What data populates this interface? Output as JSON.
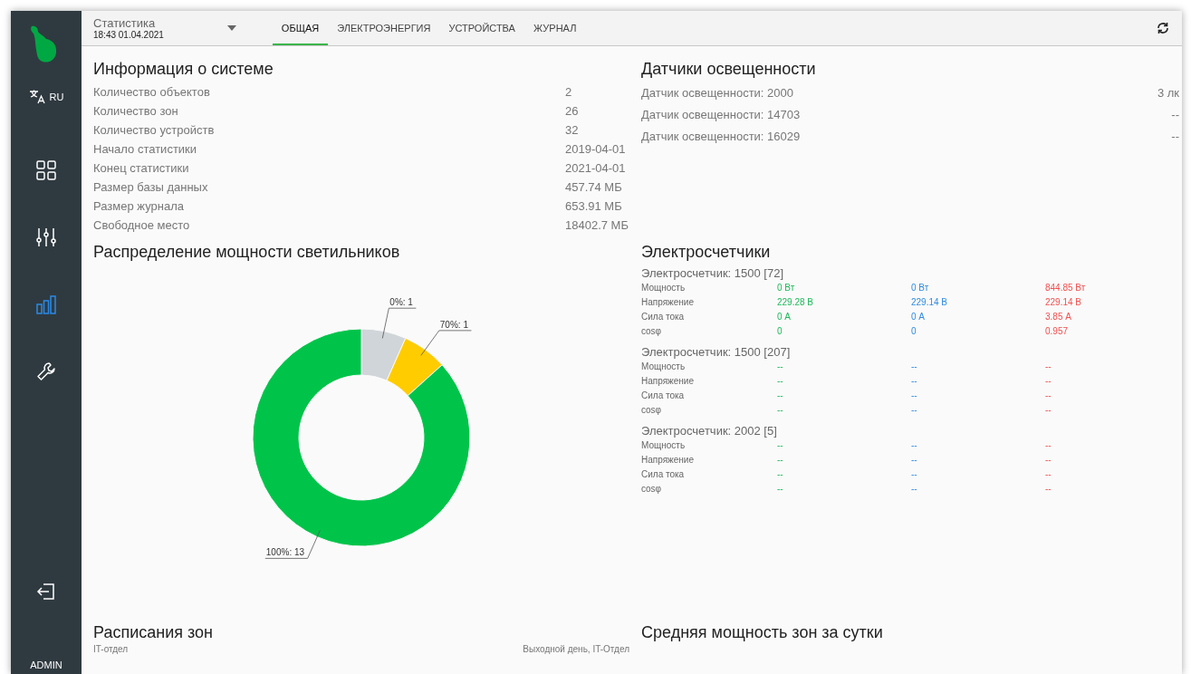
{
  "sidebar": {
    "language": "RU",
    "items": [
      {
        "selected": false
      },
      {
        "selected": false
      },
      {
        "selected": true
      },
      {
        "selected": false
      }
    ],
    "user": "ADMIN"
  },
  "header": {
    "title": "Статистика",
    "datetime": "18:43 01.04.2021",
    "tabs": [
      {
        "label": "ОБЩАЯ",
        "selected": true
      },
      {
        "label": "ЭЛЕКТРОЭНЕРГИЯ",
        "selected": false
      },
      {
        "label": "УСТРОЙСТВА",
        "selected": false
      },
      {
        "label": "ЖУРНАЛ",
        "selected": false
      }
    ]
  },
  "system_info": {
    "title": "Информация о системе",
    "rows": [
      {
        "label": "Количество объектов",
        "value": "2"
      },
      {
        "label": "Количество зон",
        "value": "26"
      },
      {
        "label": "Количество устройств",
        "value": "32"
      },
      {
        "label": "Начало статистики",
        "value": "2019-04-01"
      },
      {
        "label": "Конец статистики",
        "value": "2021-04-01"
      },
      {
        "label": "Размер базы данных",
        "value": "457.74 МБ"
      },
      {
        "label": "Размер журнала",
        "value": "653.91 МБ"
      },
      {
        "label": "Свободное место",
        "value": "18402.7 МБ"
      }
    ]
  },
  "light_sensors": {
    "title": "Датчики освещенности",
    "rows": [
      {
        "label": "Датчик освещенности: 2000",
        "value": "3 лк"
      },
      {
        "label": "Датчик освещенности: 14703",
        "value": "--"
      },
      {
        "label": "Датчик освещенности: 16029",
        "value": "--"
      }
    ]
  },
  "power_distribution": {
    "title": "Распределение мощности светильников",
    "chart_data": {
      "type": "donut",
      "values": [
        1,
        1,
        13
      ],
      "colors": [
        "#d0d5d9",
        "#ffcc00",
        "#00c44a"
      ],
      "value_labels": [
        "0%: 1",
        "70%: 1",
        "100%: 13"
      ]
    }
  },
  "meters": {
    "title": "Электросчетчики",
    "phases": [
      {
        "color": "#1fb85a"
      },
      {
        "color": "#2f8be0"
      },
      {
        "color": "#f25050"
      }
    ],
    "items": [
      {
        "name": "Электросчетчик: 1500 [72]",
        "rows": [
          {
            "label": "Мощность",
            "values": [
              "0 Вт",
              "0 Вт",
              "844.85 Вт"
            ]
          },
          {
            "label": "Напряжение",
            "values": [
              "229.28 В",
              "229.14 В",
              "229.14 В"
            ]
          },
          {
            "label": "Сила тока",
            "values": [
              "0 А",
              "0 А",
              "3.85 А"
            ]
          },
          {
            "label": "cosφ",
            "values": [
              "0",
              "0",
              "0.957"
            ]
          }
        ]
      },
      {
        "name": "Электросчетчик: 1500 [207]",
        "rows": [
          {
            "label": "Мощность",
            "values": [
              "--",
              "--",
              "--"
            ]
          },
          {
            "label": "Напряжение",
            "values": [
              "--",
              "--",
              "--"
            ]
          },
          {
            "label": "Сила тока",
            "values": [
              "--",
              "--",
              "--"
            ]
          },
          {
            "label": "cosφ",
            "values": [
              "--",
              "--",
              "--"
            ]
          }
        ]
      },
      {
        "name": "Электросчетчик: 2002 [5]",
        "rows": [
          {
            "label": "Мощность",
            "values": [
              "--",
              "--",
              "--"
            ]
          },
          {
            "label": "Напряжение",
            "values": [
              "--",
              "--",
              "--"
            ]
          },
          {
            "label": "Сила тока",
            "values": [
              "--",
              "--",
              "--"
            ]
          },
          {
            "label": "cosφ",
            "values": [
              "--",
              "--",
              "--"
            ]
          }
        ]
      }
    ]
  },
  "zone_schedules": {
    "title": "Расписания зон",
    "labels": [
      "IT-отдел",
      "Выходной день, IT-Отдел"
    ]
  },
  "zone_average_power": {
    "title": "Средняя мощность зон за сутки"
  }
}
